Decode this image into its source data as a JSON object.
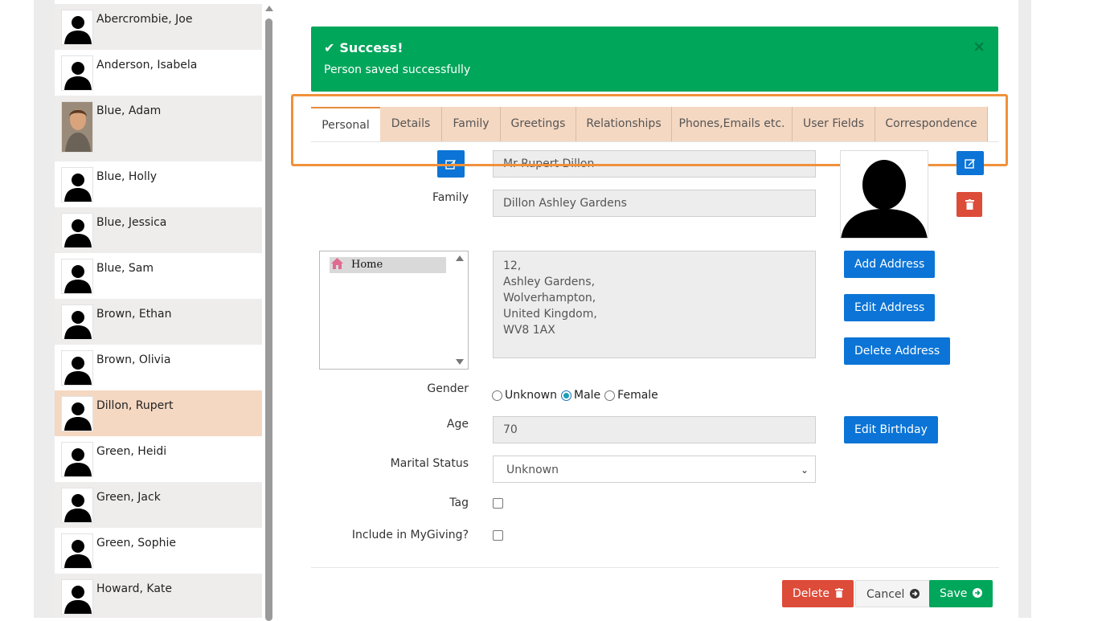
{
  "people": [
    {
      "name": "Abercrombie, Joe"
    },
    {
      "name": "Anderson, Isabela"
    },
    {
      "name": "Blue, Adam"
    },
    {
      "name": "Blue, Holly"
    },
    {
      "name": "Blue, Jessica"
    },
    {
      "name": "Blue, Sam"
    },
    {
      "name": "Brown, Ethan"
    },
    {
      "name": "Brown, Olivia"
    },
    {
      "name": "Dillon, Rupert"
    },
    {
      "name": "Green, Heidi"
    },
    {
      "name": "Green, Jack"
    },
    {
      "name": "Green, Sophie"
    },
    {
      "name": "Howard, Kate"
    }
  ],
  "alert": {
    "title": "Success!",
    "message": "Person saved successfully",
    "close": "×",
    "color": "#00a65a"
  },
  "tabs": [
    "Personal",
    "Details",
    "Family",
    "Greetings",
    "Relationships",
    "Phones,Emails etc.",
    "User Fields",
    "Correspondence"
  ],
  "active_tab": "Personal",
  "form": {
    "name_value": "Mr Rupert Dillon",
    "family_label": "Family",
    "family_value": "Dillon Ashley Gardens",
    "address_list_item": "Home",
    "address_lines": [
      "12,",
      "Ashley Gardens,",
      "Wolverhampton,",
      "United Kingdom,",
      "WV8 1AX"
    ],
    "add_address": "Add Address",
    "edit_address": "Edit Address",
    "delete_address": "Delete Address",
    "gender_label": "Gender",
    "gender_options": [
      "Unknown",
      "Male",
      "Female"
    ],
    "gender_selected": "Male",
    "age_label": "Age",
    "age_value": "70",
    "edit_birthday": "Edit Birthday",
    "marital_label": "Marital Status",
    "marital_value": "Unknown",
    "tag_label": "Tag",
    "mygiving_label": "Include in MyGiving?"
  },
  "actions": {
    "delete": "Delete",
    "cancel": "Cancel",
    "save": "Save"
  },
  "colors": {
    "tab_bg": "#f5d8c2",
    "selected_row": "#f5d8c2",
    "highlight": "#f0913a",
    "primary": "#0b74d6",
    "danger": "#dd4b39",
    "success": "#00a65a"
  }
}
